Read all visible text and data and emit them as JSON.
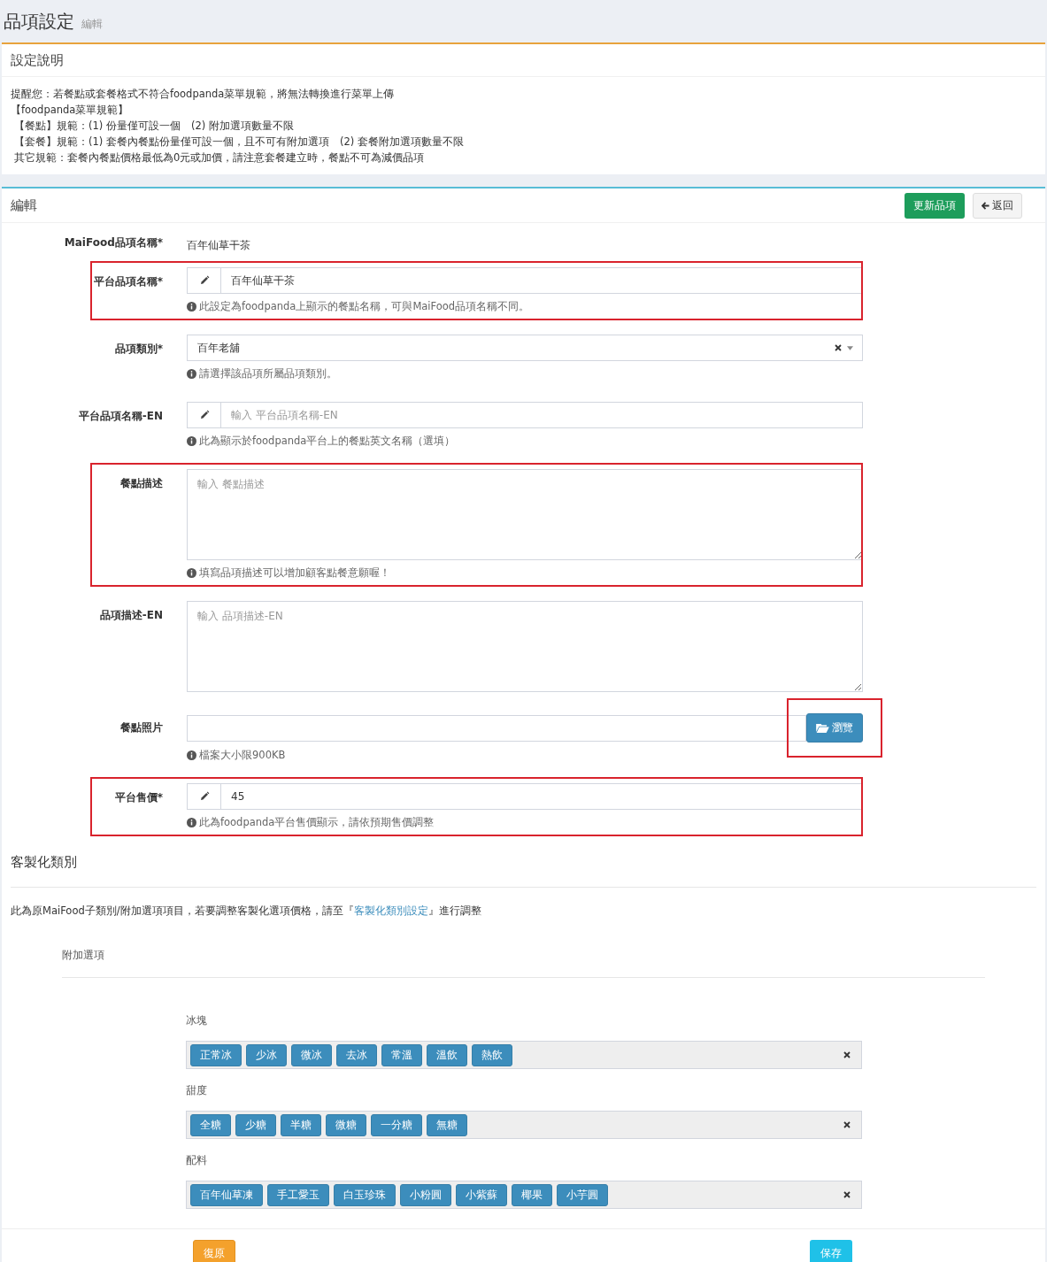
{
  "page": {
    "title": "品項設定",
    "subtitle": "編輯"
  },
  "notice": {
    "title": "設定說明",
    "lines": [
      "提醒您：若餐點或套餐格式不符合foodpanda菜單規範，將無法轉換進行菜單上傳",
      "【foodpanda菜單規範】",
      "【餐點】規範：(1) 份量僅可設一個　(2) 附加選項數量不限",
      "【套餐】規範：(1) 套餐內餐點份量僅可設一個，且不可有附加選項　(2) 套餐附加選項數量不限",
      "其它規範：套餐內餐點價格最低為0元或加價，請注意套餐建立時，餐點不可為減價品項"
    ]
  },
  "editor": {
    "title": "編輯",
    "buttons": [
      {
        "label": "更新品項",
        "kind": "primary"
      },
      {
        "label": "返回",
        "kind": "back"
      }
    ],
    "fields": [
      {
        "kind": "static",
        "label": "MaiFood品項名稱*",
        "value": "百年仙草干茶",
        "highlighted": false
      },
      {
        "kind": "addon-input",
        "label": "平台品項名稱*",
        "value": "百年仙草干茶",
        "help": "此設定為foodpanda上顯示的餐點名稱，可與MaiFood品項名稱不同。",
        "highlighted": true
      },
      {
        "kind": "select",
        "label": "品項類別*",
        "value": "百年老舖",
        "help": "請選擇該品項所屬品項類別。",
        "highlighted": false
      },
      {
        "kind": "addon-input",
        "label": "平台品項名稱-EN",
        "placeholder": "輸入 平台品項名稱-EN",
        "help": "此為顯示於foodpanda平台上的餐點英文名稱（選填）",
        "highlighted": false
      },
      {
        "kind": "textarea",
        "label": "餐點描述",
        "placeholder": "輸入 餐點描述",
        "help": "填寫品項描述可以增加顧客點餐意願喔！",
        "highlighted": true
      },
      {
        "kind": "textarea",
        "label": "品項描述-EN",
        "placeholder": "輸入 品項描述-EN",
        "highlighted": false
      },
      {
        "kind": "file",
        "label": "餐點照片",
        "button": "瀏覽",
        "help": "檔案大小限900KB",
        "highlighted": true
      },
      {
        "kind": "addon-input",
        "label": "平台售價*",
        "value": "45",
        "help": "此為foodpanda平台售價顯示，請依預期售價調整",
        "highlighted": true
      }
    ]
  },
  "customization": {
    "title": "客製化類別",
    "note_before": "此為原MaiFood子類別/附加選項項目，若要調整客製化選項價格，請至『",
    "note_link": "客製化類別設定",
    "note_after": "』進行調整",
    "section": "附加選項",
    "groups": [
      {
        "label": "冰塊",
        "tags": [
          "正常冰",
          "少冰",
          "微冰",
          "去冰",
          "常溫",
          "溫飲",
          "熱飲"
        ]
      },
      {
        "label": "甜度",
        "tags": [
          "全糖",
          "少糖",
          "半糖",
          "微糖",
          "一分糖",
          "無糖"
        ]
      },
      {
        "label": "配料",
        "tags": [
          "百年仙草凍",
          "手工愛玉",
          "白玉珍珠",
          "小粉圓",
          "小紫蘇",
          "椰果",
          "小芋圓"
        ]
      }
    ]
  },
  "footer": {
    "buttons": [
      {
        "label": "復原",
        "kind": "warning"
      },
      {
        "label": "保存",
        "kind": "info"
      }
    ]
  }
}
